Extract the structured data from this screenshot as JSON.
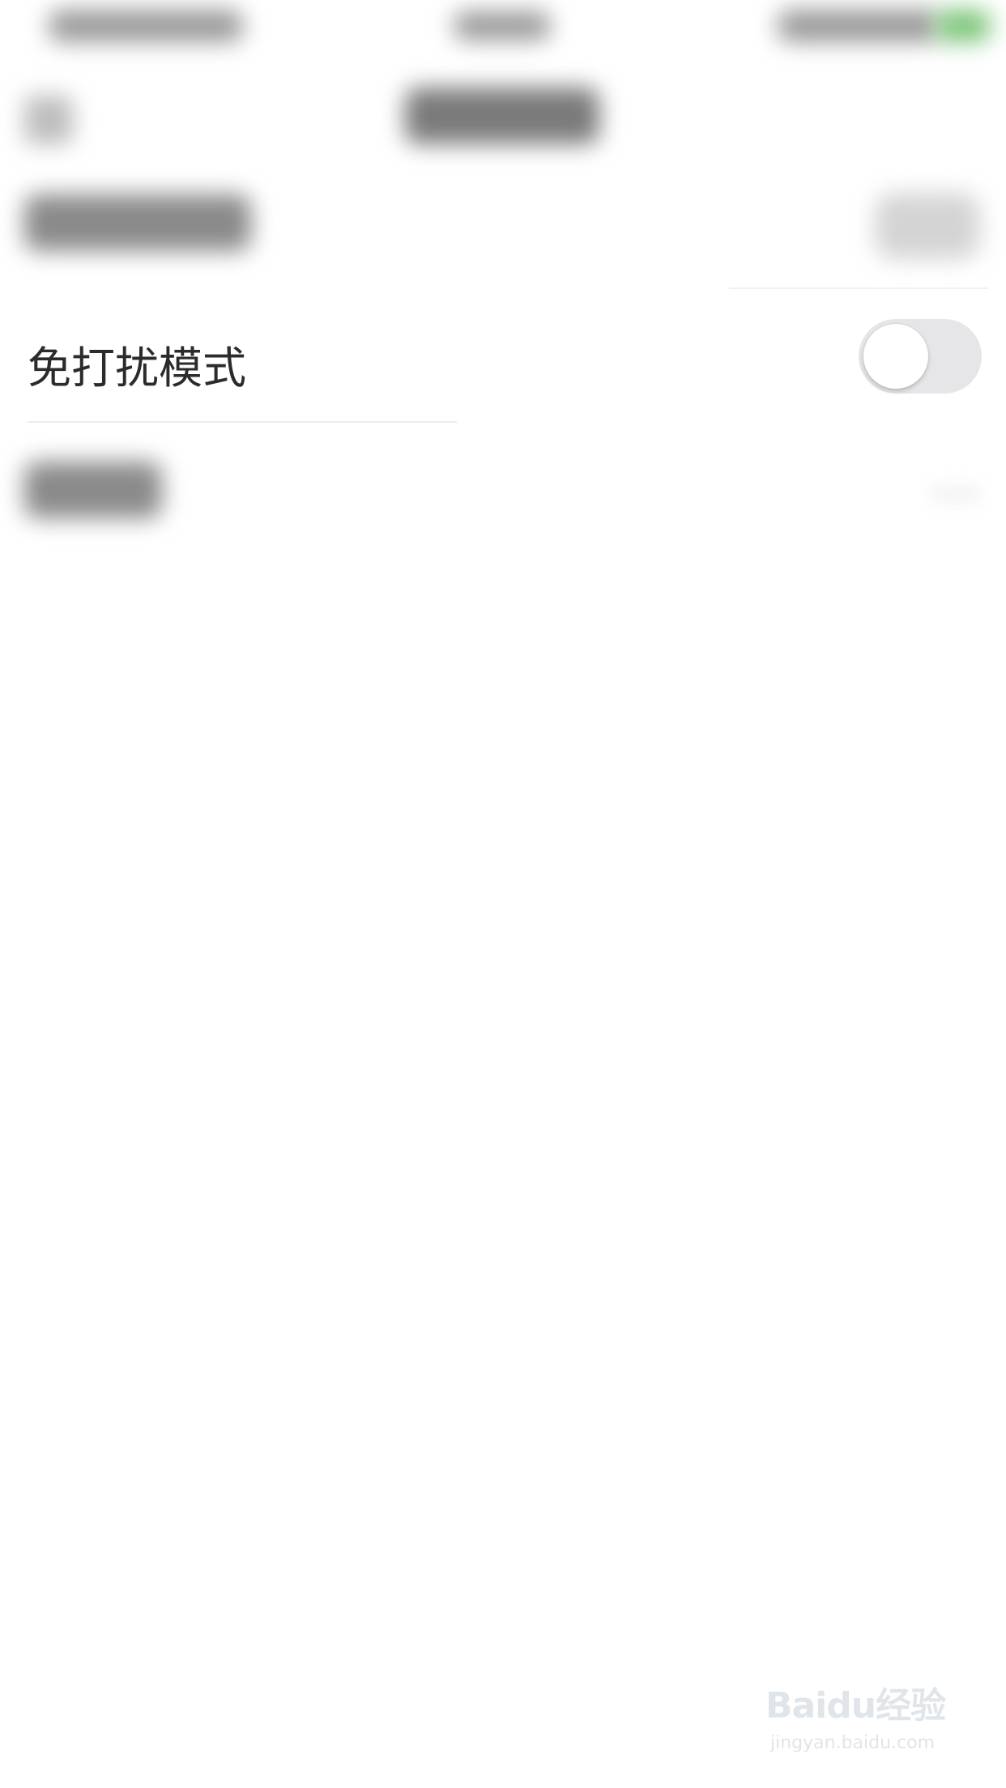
{
  "settings": {
    "dnd_label": "免打扰模式",
    "dnd_toggle_on": false
  },
  "watermark": {
    "logo": "Baidu经验",
    "sub": "jingyan.baidu.com"
  }
}
